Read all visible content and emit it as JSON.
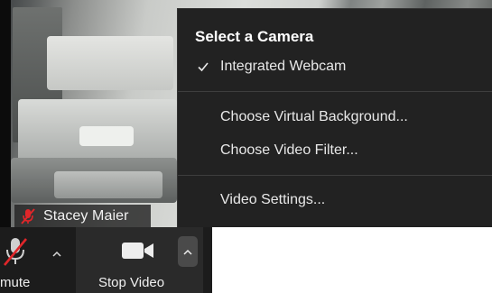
{
  "video": {
    "participant_name": "Stacey Maier",
    "muted": true
  },
  "camera_menu": {
    "header": "Select a Camera",
    "cameras": [
      {
        "label": "Integrated Webcam",
        "selected": true
      }
    ],
    "items": [
      {
        "label": "Choose Virtual Background..."
      },
      {
        "label": "Choose Video Filter..."
      },
      {
        "label": "Video Settings..."
      }
    ]
  },
  "toolbar": {
    "mute_label": "mute",
    "stop_video_label": "Stop Video"
  },
  "colors": {
    "menu_bg": "#222222",
    "toolbar_bg": "#1c1c1c",
    "mic_muted_red": "#e0262a"
  }
}
